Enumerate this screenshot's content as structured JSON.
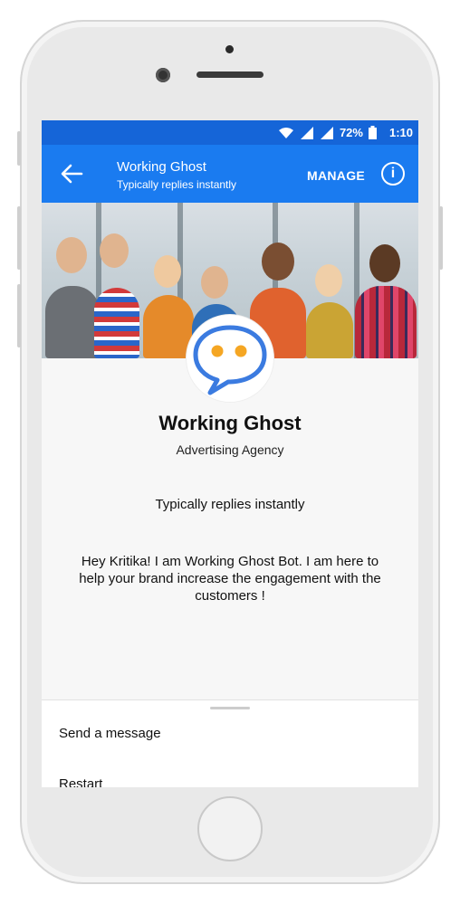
{
  "status_bar": {
    "battery": "72%",
    "time": "1:10"
  },
  "app_bar": {
    "title": "Working Ghost",
    "subtitle": "Typically replies instantly",
    "manage_label": "MANAGE"
  },
  "profile": {
    "name": "Working Ghost",
    "category": "Advertising Agency",
    "response_status": "Typically replies instantly",
    "intro_message": "Hey Kritika! I am Working Ghost Bot. I am here to help your brand increase the engagement with the customers !"
  },
  "actions": [
    {
      "label": "Send a message"
    },
    {
      "label": "Restart"
    }
  ],
  "colors": {
    "status_bar": "#1565d8",
    "app_bar": "#1a7bf0",
    "logo_stroke": "#3b7be0",
    "logo_eyes": "#f5a623"
  },
  "icons": [
    "back-arrow-icon",
    "info-icon",
    "wifi-icon",
    "signal-icon",
    "battery-icon"
  ]
}
